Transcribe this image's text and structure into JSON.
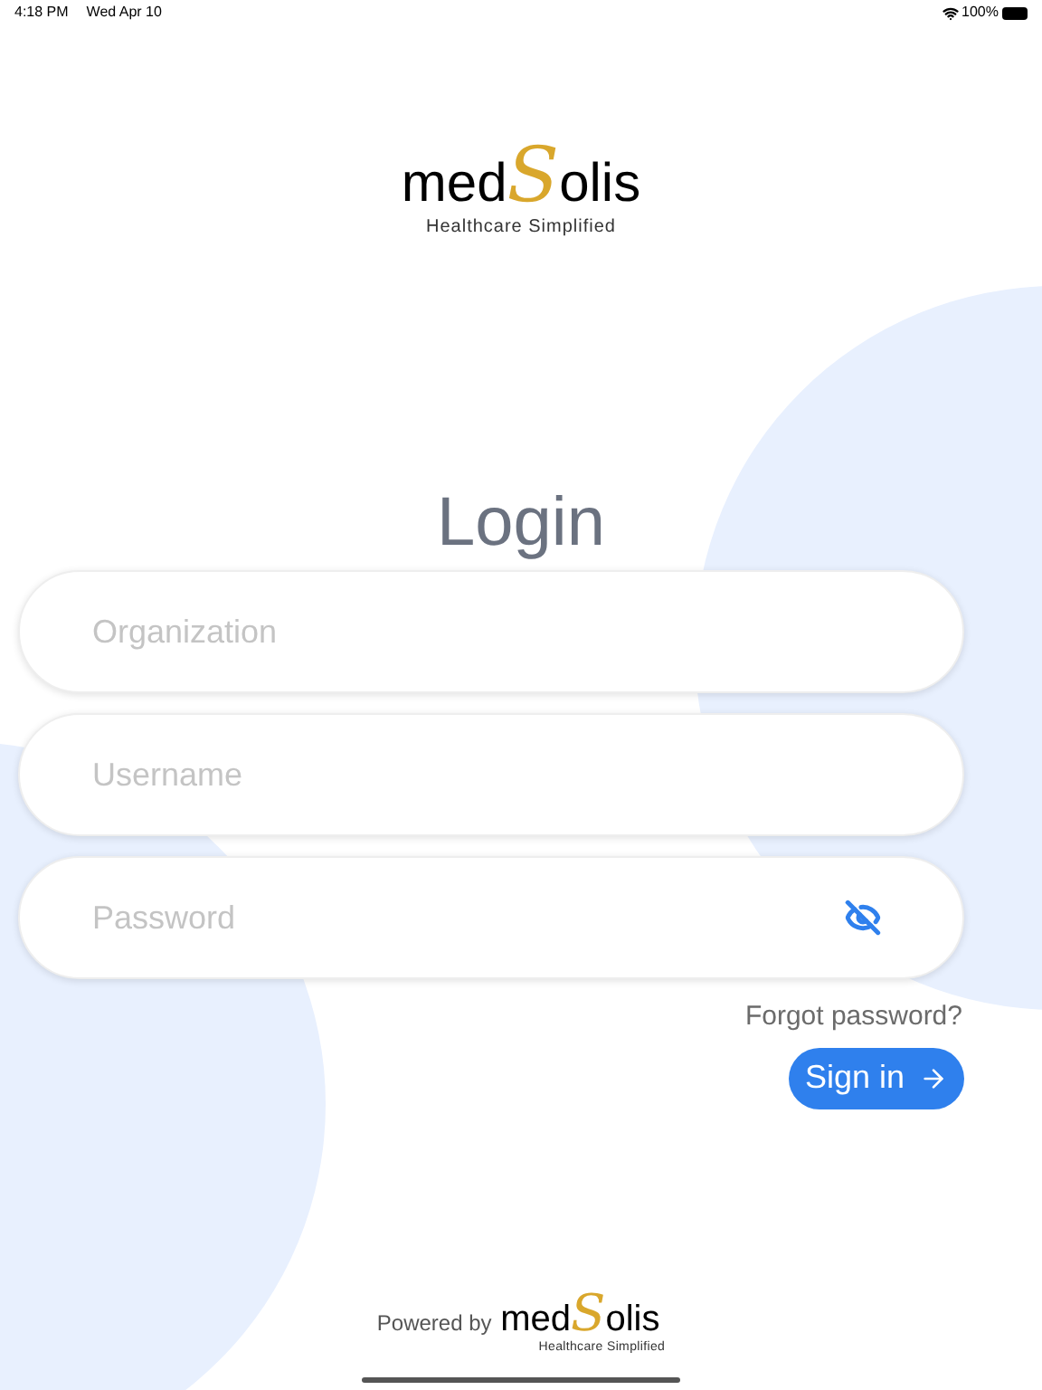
{
  "status_bar": {
    "time": "4:18 PM",
    "date": "Wed Apr 10",
    "battery": "100%"
  },
  "logo": {
    "first": "med",
    "initial": "S",
    "rest": "olis",
    "tagline": "Healthcare Simplified"
  },
  "title": "Login",
  "fields": [
    {
      "placeholder": "Organization",
      "kind": "text"
    },
    {
      "placeholder": "Username",
      "kind": "text"
    },
    {
      "placeholder": "Password",
      "kind": "password"
    }
  ],
  "forgot_link": "Forgot password?",
  "sign_in_button": "Sign in",
  "footer": {
    "powered_by": "Powered by",
    "logo": {
      "first": "med",
      "initial": "S",
      "rest": "olis",
      "tagline": "Healthcare Simplified"
    }
  }
}
